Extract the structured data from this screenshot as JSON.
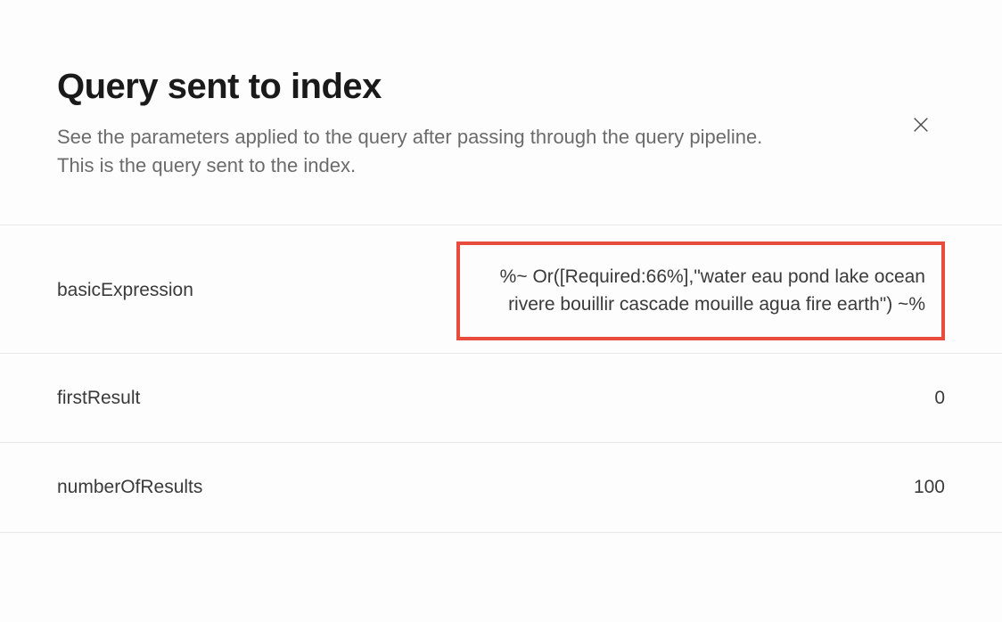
{
  "header": {
    "title": "Query sent to index",
    "subtitle": "See the parameters applied to the query after passing through the query pipeline. This is the query sent to the index."
  },
  "rows": [
    {
      "key": "basicExpression",
      "value": "%~ Or([Required:66%],\"water eau pond lake ocean rivere bouillir cascade mouille agua fire earth\") ~%",
      "highlighted": true
    },
    {
      "key": "firstResult",
      "value": "0",
      "highlighted": false
    },
    {
      "key": "numberOfResults",
      "value": "100",
      "highlighted": false
    }
  ]
}
